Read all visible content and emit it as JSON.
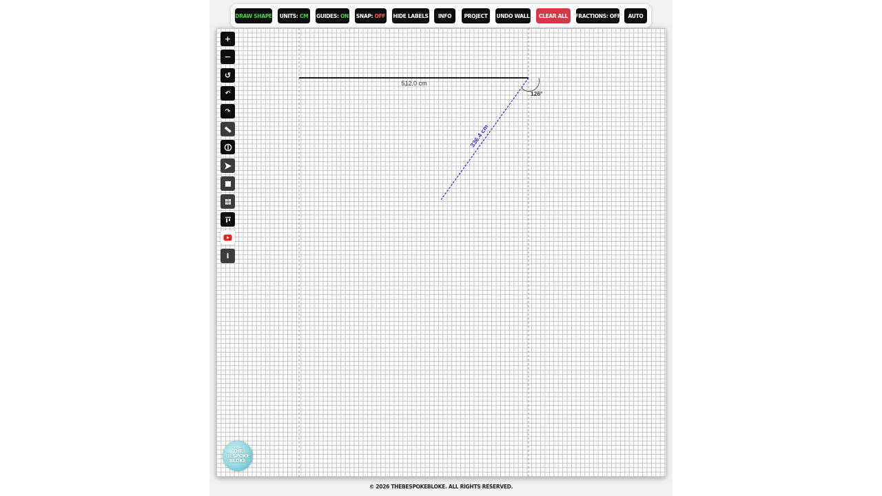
{
  "toolbar": {
    "draw_shape": "DRAW SHAPE",
    "units_label": "UNITS:",
    "units_value": "CM",
    "guides_label": "GUIDES:",
    "guides_value": "ON",
    "snap_label": "SNAP:",
    "snap_value": "OFF",
    "hide_labels": "HIDE LABELS",
    "info": "INFO",
    "project": "PROJECT",
    "undo_wall": "UNDO WALL",
    "clear_all": "CLEAR ALL",
    "fractions": "FRACTIONS: OFF",
    "auto": "AUTO"
  },
  "colors": {
    "button_bg": "#0d0d0d",
    "clear_all_bg": "#d33a45",
    "on_value": "#3fd93f",
    "off_value": "#ff5a36",
    "wall_line": "#1a1a1a",
    "preview_line": "#2a1fe0"
  },
  "sidebar": {
    "items": [
      {
        "name": "zoom-in-button",
        "icon": "plus-icon",
        "glyph": "+"
      },
      {
        "name": "zoom-out-button",
        "icon": "minus-icon",
        "glyph": "−"
      },
      {
        "name": "reset-view-button",
        "icon": "rotate-icon",
        "glyph": "↺"
      },
      {
        "name": "undo-button",
        "icon": "undo-icon",
        "glyph": "↶"
      },
      {
        "name": "redo-button",
        "icon": "redo-icon",
        "glyph": "↷"
      },
      {
        "name": "measure-button",
        "icon": "ruler-icon",
        "glyph": ""
      },
      {
        "name": "door-button",
        "icon": "door-icon",
        "glyph": ""
      },
      {
        "name": "select-button",
        "icon": "pointer-icon",
        "glyph": ""
      },
      {
        "name": "window-button",
        "icon": "square-icon",
        "glyph": ""
      },
      {
        "name": "grid-button",
        "icon": "grid-icon",
        "glyph": ""
      },
      {
        "name": "align-top-button",
        "icon": "align-top-icon",
        "glyph": ""
      },
      {
        "name": "youtube-button",
        "icon": "youtube-icon",
        "glyph": ""
      },
      {
        "name": "about-button",
        "icon": "info-icon",
        "glyph": "i"
      }
    ]
  },
  "drawing": {
    "wall_label": "512.0 cm",
    "preview_label": "336.4 cm",
    "angle_label": "126°"
  },
  "logo": {
    "text": "THE BESPOKE BLOKE"
  },
  "footer": {
    "copyright": "© 2026 THEBESPOKEBLOKE. ALL RIGHTS RESERVED."
  }
}
